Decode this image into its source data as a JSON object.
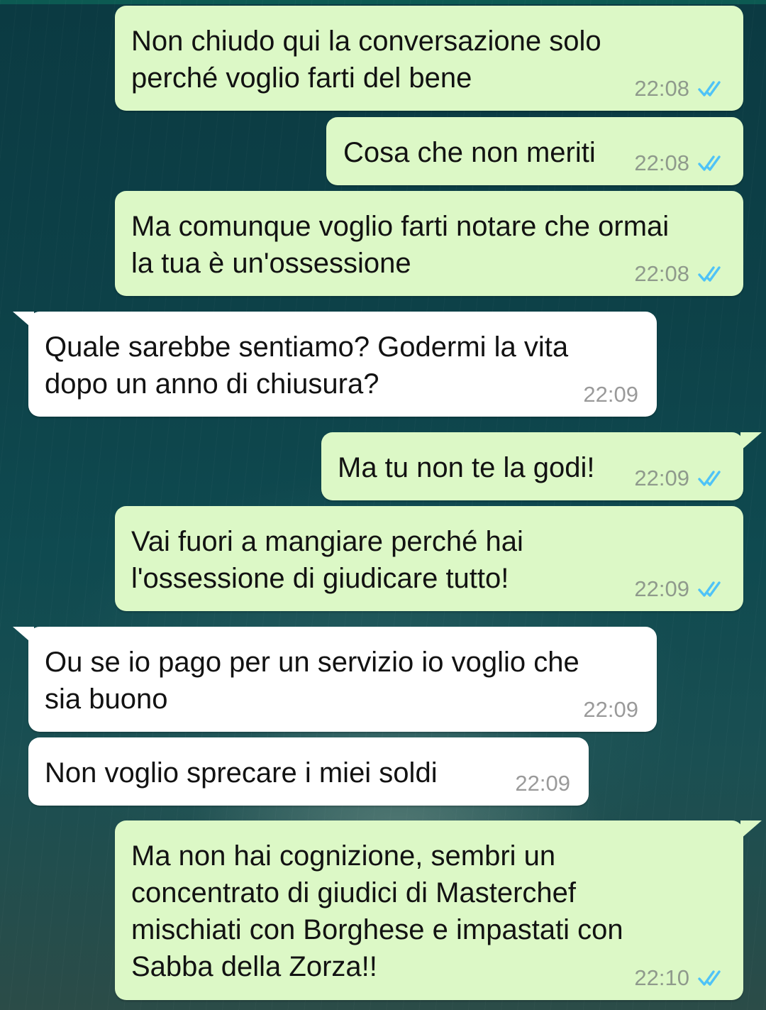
{
  "messages": [
    {
      "dir": "out",
      "text": "Non chiudo qui la conversazione solo\nperché voglio farti del bene",
      "time": "22:08",
      "status_icon": "double-check-read"
    },
    {
      "dir": "out",
      "text": "Cosa che non meriti",
      "time": "22:08",
      "status_icon": "double-check-read"
    },
    {
      "dir": "out",
      "text": "Ma comunque voglio farti notare che ormai\nla tua è un'ossessione",
      "time": "22:08",
      "status_icon": "double-check-read"
    },
    {
      "dir": "in",
      "text": "Quale sarebbe sentiamo? Godermi la vita\ndopo un anno di chiusura?",
      "time": "22:09"
    },
    {
      "dir": "out",
      "text": "Ma tu non te la godi!",
      "time": "22:09",
      "status_icon": "double-check-read"
    },
    {
      "dir": "out",
      "text": "Vai fuori a mangiare perché hai\nl'ossessione di giudicare tutto!",
      "time": "22:09",
      "status_icon": "double-check-read"
    },
    {
      "dir": "in",
      "text": "Ou se io pago per un servizio io voglio che\nsia buono",
      "time": "22:09"
    },
    {
      "dir": "in",
      "text": "Non voglio sprecare i miei soldi",
      "time": "22:09"
    },
    {
      "dir": "out",
      "text": "Ma non hai cognizione, sembri un\nconcentrato di giudici di Masterchef\nmischiati con Borghese e impastati con\nSabba della Zorza!!",
      "time": "22:10",
      "status_icon": "double-check-read"
    }
  ],
  "colors": {
    "outgoing_bubble": "#dcf8c6",
    "incoming_bubble": "#ffffff",
    "read_ticks": "#4fc3f7",
    "background": "#0d4148"
  }
}
